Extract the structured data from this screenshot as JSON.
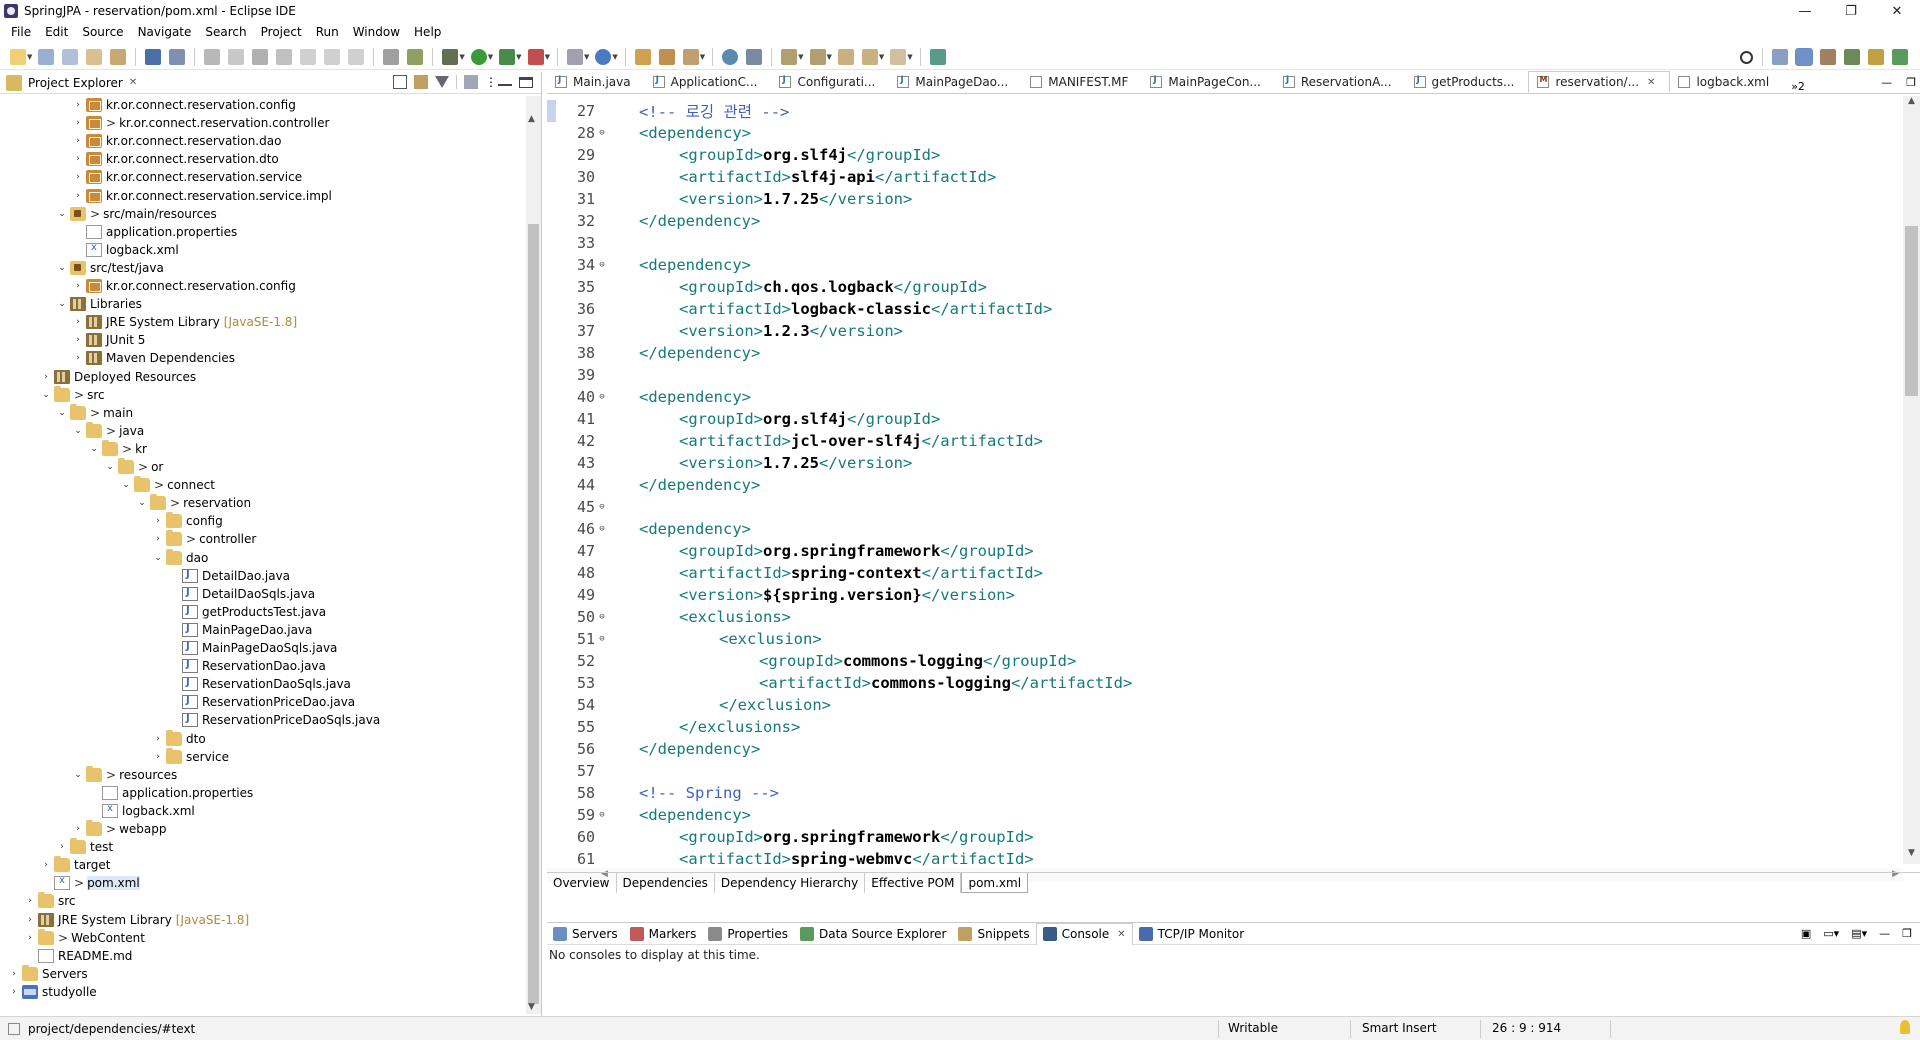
{
  "window": {
    "title": "SpringJPA - reservation/pom.xml - Eclipse IDE"
  },
  "menu": [
    "File",
    "Edit",
    "Source",
    "Navigate",
    "Search",
    "Project",
    "Run",
    "Window",
    "Help"
  ],
  "explorer": {
    "tab_label": "Project Explorer",
    "tree": [
      {
        "depth": 5,
        "tw": ">",
        "icon": "pkg",
        "gt": "",
        "label": "kr.or.connect.reservation.config"
      },
      {
        "depth": 5,
        "tw": ">",
        "icon": "pkg",
        "gt": ">",
        "label": "kr.or.connect.reservation.controller"
      },
      {
        "depth": 5,
        "tw": ">",
        "icon": "pkg",
        "gt": "",
        "label": "kr.or.connect.reservation.dao"
      },
      {
        "depth": 5,
        "tw": ">",
        "icon": "pkg",
        "gt": "",
        "label": "kr.or.connect.reservation.dto"
      },
      {
        "depth": 5,
        "tw": ">",
        "icon": "pkg",
        "gt": "",
        "label": "kr.or.connect.reservation.service"
      },
      {
        "depth": 5,
        "tw": ">",
        "icon": "pkg",
        "gt": "",
        "label": "kr.or.connect.reservation.service.impl"
      },
      {
        "depth": 4,
        "tw": "v",
        "icon": "srcf",
        "gt": ">",
        "label": "src/main/resources"
      },
      {
        "depth": 5,
        "tw": "",
        "icon": "file",
        "gt": "",
        "label": "application.properties"
      },
      {
        "depth": 5,
        "tw": "",
        "icon": "xml",
        "gt": "",
        "label": "logback.xml"
      },
      {
        "depth": 4,
        "tw": "v",
        "icon": "srcf",
        "gt": "",
        "label": "src/test/java"
      },
      {
        "depth": 5,
        "tw": ">",
        "icon": "pkg",
        "gt": "",
        "label": "kr.or.connect.reservation.config"
      },
      {
        "depth": 4,
        "tw": "v",
        "icon": "lib",
        "gt": "",
        "label": "Libraries"
      },
      {
        "depth": 5,
        "tw": ">",
        "icon": "lib",
        "gt": "",
        "label": "JRE System Library",
        "ann": "[JavaSE-1.8]"
      },
      {
        "depth": 5,
        "tw": ">",
        "icon": "lib",
        "gt": "",
        "label": "JUnit 5"
      },
      {
        "depth": 5,
        "tw": ">",
        "icon": "lib",
        "gt": "",
        "label": "Maven Dependencies"
      },
      {
        "depth": 3,
        "tw": ">",
        "icon": "lib",
        "gt": "",
        "label": "Deployed Resources"
      },
      {
        "depth": 3,
        "tw": "v",
        "icon": "folder",
        "gt": ">",
        "label": "src"
      },
      {
        "depth": 4,
        "tw": "v",
        "icon": "folder",
        "gt": ">",
        "label": "main"
      },
      {
        "depth": 5,
        "tw": "v",
        "icon": "folder",
        "gt": ">",
        "label": "java"
      },
      {
        "depth": 6,
        "tw": "v",
        "icon": "folder",
        "gt": ">",
        "label": "kr"
      },
      {
        "depth": 7,
        "tw": "v",
        "icon": "folder",
        "gt": ">",
        "label": "or"
      },
      {
        "depth": 8,
        "tw": "v",
        "icon": "folder",
        "gt": ">",
        "label": "connect"
      },
      {
        "depth": 9,
        "tw": "v",
        "icon": "folder",
        "gt": ">",
        "label": "reservation"
      },
      {
        "depth": 10,
        "tw": ">",
        "icon": "folder",
        "gt": "",
        "label": "config"
      },
      {
        "depth": 10,
        "tw": ">",
        "icon": "folder",
        "gt": ">",
        "label": "controller"
      },
      {
        "depth": 10,
        "tw": "v",
        "icon": "folder",
        "gt": "",
        "label": "dao"
      },
      {
        "depth": 11,
        "tw": "",
        "icon": "java",
        "gt": "",
        "label": "DetailDao.java"
      },
      {
        "depth": 11,
        "tw": "",
        "icon": "java",
        "gt": "",
        "label": "DetailDaoSqls.java"
      },
      {
        "depth": 11,
        "tw": "",
        "icon": "java",
        "gt": "",
        "label": "getProductsTest.java"
      },
      {
        "depth": 11,
        "tw": "",
        "icon": "java",
        "gt": "",
        "label": "MainPageDao.java"
      },
      {
        "depth": 11,
        "tw": "",
        "icon": "java",
        "gt": "",
        "label": "MainPageDaoSqls.java"
      },
      {
        "depth": 11,
        "tw": "",
        "icon": "java",
        "gt": "",
        "label": "ReservationDao.java"
      },
      {
        "depth": 11,
        "tw": "",
        "icon": "java",
        "gt": "",
        "label": "ReservationDaoSqls.java"
      },
      {
        "depth": 11,
        "tw": "",
        "icon": "java",
        "gt": "",
        "label": "ReservationPriceDao.java"
      },
      {
        "depth": 11,
        "tw": "",
        "icon": "java",
        "gt": "",
        "label": "ReservationPriceDaoSqls.java"
      },
      {
        "depth": 10,
        "tw": ">",
        "icon": "folder",
        "gt": "",
        "label": "dto"
      },
      {
        "depth": 10,
        "tw": ">",
        "icon": "folder",
        "gt": "",
        "label": "service"
      },
      {
        "depth": 5,
        "tw": "v",
        "icon": "folder",
        "gt": ">",
        "label": "resources"
      },
      {
        "depth": 6,
        "tw": "",
        "icon": "file",
        "gt": "",
        "label": "application.properties"
      },
      {
        "depth": 6,
        "tw": "",
        "icon": "xml",
        "gt": "",
        "label": "logback.xml"
      },
      {
        "depth": 5,
        "tw": ">",
        "icon": "folder",
        "gt": ">",
        "label": "webapp"
      },
      {
        "depth": 4,
        "tw": ">",
        "icon": "folder",
        "gt": "",
        "label": "test"
      },
      {
        "depth": 3,
        "tw": ">",
        "icon": "folder",
        "gt": "",
        "label": "target"
      },
      {
        "depth": 3,
        "tw": "",
        "icon": "xml",
        "gt": ">",
        "label": "pom.xml",
        "selected": true
      },
      {
        "depth": 2,
        "tw": ">",
        "icon": "folder",
        "gt": "",
        "label": "src"
      },
      {
        "depth": 2,
        "tw": ">",
        "icon": "lib",
        "gt": "",
        "label": "JRE System Library",
        "ann": "[JavaSE-1.8]"
      },
      {
        "depth": 2,
        "tw": ">",
        "icon": "folder",
        "gt": ">",
        "label": "WebContent"
      },
      {
        "depth": 2,
        "tw": "",
        "icon": "file",
        "gt": "",
        "label": "README.md"
      },
      {
        "depth": 1,
        "tw": ">",
        "icon": "folder",
        "gt": "",
        "label": "Servers"
      },
      {
        "depth": 1,
        "tw": ">",
        "icon": "proj",
        "gt": "",
        "label": "studyolle"
      }
    ]
  },
  "editor": {
    "tabs": [
      {
        "label": "Main.java",
        "icon": "j"
      },
      {
        "label": "ApplicationC...",
        "icon": "j"
      },
      {
        "label": "Configurati...",
        "icon": "j"
      },
      {
        "label": "MainPageDao...",
        "icon": "j"
      },
      {
        "label": "MANIFEST.MF",
        "icon": "f"
      },
      {
        "label": "MainPageCon...",
        "icon": "j"
      },
      {
        "label": "ReservationA...",
        "icon": "j"
      },
      {
        "label": "getProducts...",
        "icon": "j"
      },
      {
        "label": "reservation/...",
        "icon": "m",
        "active": true
      },
      {
        "label": "logback.xml",
        "icon": "x"
      }
    ],
    "more_tabs": "»2",
    "lines": [
      {
        "n": "27",
        "fold": "",
        "indent": 1,
        "parts": [
          [
            "cmt",
            "<!-- 로깅 관련 -->"
          ]
        ]
      },
      {
        "n": "28",
        "fold": "⊖",
        "indent": 1,
        "parts": [
          [
            "tag",
            "<dependency>"
          ]
        ]
      },
      {
        "n": "29",
        "fold": "",
        "indent": 2,
        "parts": [
          [
            "tag",
            "<groupId>"
          ],
          [
            "txtb",
            "org.slf4j"
          ],
          [
            "tag",
            "</groupId>"
          ]
        ]
      },
      {
        "n": "30",
        "fold": "",
        "indent": 2,
        "parts": [
          [
            "tag",
            "<artifactId>"
          ],
          [
            "txtb",
            "slf4j-api"
          ],
          [
            "tag",
            "</artifactId>"
          ]
        ]
      },
      {
        "n": "31",
        "fold": "",
        "indent": 2,
        "parts": [
          [
            "tag",
            "<version>"
          ],
          [
            "txtb",
            "1.7.25"
          ],
          [
            "tag",
            "</version>"
          ]
        ]
      },
      {
        "n": "32",
        "fold": "",
        "indent": 1,
        "parts": [
          [
            "tag",
            "</dependency>"
          ]
        ]
      },
      {
        "n": "33",
        "fold": "",
        "indent": 0,
        "parts": []
      },
      {
        "n": "34",
        "fold": "⊖",
        "indent": 1,
        "parts": [
          [
            "tag",
            "<dependency>"
          ]
        ]
      },
      {
        "n": "35",
        "fold": "",
        "indent": 2,
        "parts": [
          [
            "tag",
            "<groupId>"
          ],
          [
            "txtb",
            "ch.qos.logback"
          ],
          [
            "tag",
            "</groupId>"
          ]
        ]
      },
      {
        "n": "36",
        "fold": "",
        "indent": 2,
        "parts": [
          [
            "tag",
            "<artifactId>"
          ],
          [
            "txtb",
            "logback-classic"
          ],
          [
            "tag",
            "</artifactId>"
          ]
        ]
      },
      {
        "n": "37",
        "fold": "",
        "indent": 2,
        "parts": [
          [
            "tag",
            "<version>"
          ],
          [
            "txtb",
            "1.2.3"
          ],
          [
            "tag",
            "</version>"
          ]
        ]
      },
      {
        "n": "38",
        "fold": "",
        "indent": 1,
        "parts": [
          [
            "tag",
            "</dependency>"
          ]
        ]
      },
      {
        "n": "39",
        "fold": "",
        "indent": 0,
        "parts": []
      },
      {
        "n": "40",
        "fold": "⊖",
        "indent": 1,
        "parts": [
          [
            "tag",
            "<dependency>"
          ]
        ]
      },
      {
        "n": "41",
        "fold": "",
        "indent": 2,
        "parts": [
          [
            "tag",
            "<groupId>"
          ],
          [
            "txtb",
            "org.slf4j"
          ],
          [
            "tag",
            "</groupId>"
          ]
        ]
      },
      {
        "n": "42",
        "fold": "",
        "indent": 2,
        "parts": [
          [
            "tag",
            "<artifactId>"
          ],
          [
            "txtb",
            "jcl-over-slf4j"
          ],
          [
            "tag",
            "</artifactId>"
          ]
        ]
      },
      {
        "n": "43",
        "fold": "",
        "indent": 2,
        "parts": [
          [
            "tag",
            "<version>"
          ],
          [
            "txtb",
            "1.7.25"
          ],
          [
            "tag",
            "</version>"
          ]
        ]
      },
      {
        "n": "44",
        "fold": "",
        "indent": 1,
        "parts": [
          [
            "tag",
            "</dependency>"
          ]
        ]
      },
      {
        "n": "45",
        "fold": "⊖",
        "indent": 0,
        "parts": []
      },
      {
        "n": "46",
        "fold": "⊖",
        "indent": 1,
        "parts": [
          [
            "tag",
            "<dependency>"
          ]
        ]
      },
      {
        "n": "47",
        "fold": "",
        "indent": 2,
        "parts": [
          [
            "tag",
            "<groupId>"
          ],
          [
            "txtb",
            "org.springframework"
          ],
          [
            "tag",
            "</groupId>"
          ]
        ]
      },
      {
        "n": "48",
        "fold": "",
        "indent": 2,
        "parts": [
          [
            "tag",
            "<artifactId>"
          ],
          [
            "txtb",
            "spring-context"
          ],
          [
            "tag",
            "</artifactId>"
          ]
        ]
      },
      {
        "n": "49",
        "fold": "",
        "indent": 2,
        "parts": [
          [
            "tag",
            "<version>"
          ],
          [
            "txtb",
            "${spring.version}"
          ],
          [
            "tag",
            "</version>"
          ]
        ]
      },
      {
        "n": "50",
        "fold": "⊖",
        "indent": 2,
        "parts": [
          [
            "tag",
            "<exclusions>"
          ]
        ]
      },
      {
        "n": "51",
        "fold": "⊖",
        "indent": 3,
        "parts": [
          [
            "tag",
            "<exclusion>"
          ]
        ]
      },
      {
        "n": "52",
        "fold": "",
        "indent": 4,
        "parts": [
          [
            "tag",
            "<groupId>"
          ],
          [
            "txtb",
            "commons-logging"
          ],
          [
            "tag",
            "</groupId>"
          ]
        ]
      },
      {
        "n": "53",
        "fold": "",
        "indent": 4,
        "parts": [
          [
            "tag",
            "<artifactId>"
          ],
          [
            "txtb",
            "commons-logging"
          ],
          [
            "tag",
            "</artifactId>"
          ]
        ]
      },
      {
        "n": "54",
        "fold": "",
        "indent": 3,
        "parts": [
          [
            "tag",
            "</exclusion>"
          ]
        ]
      },
      {
        "n": "55",
        "fold": "",
        "indent": 2,
        "parts": [
          [
            "tag",
            "</exclusions>"
          ]
        ]
      },
      {
        "n": "56",
        "fold": "",
        "indent": 1,
        "parts": [
          [
            "tag",
            "</dependency>"
          ]
        ]
      },
      {
        "n": "57",
        "fold": "",
        "indent": 0,
        "parts": []
      },
      {
        "n": "58",
        "fold": "",
        "indent": 1,
        "parts": [
          [
            "cmt",
            "<!-- Spring -->"
          ]
        ]
      },
      {
        "n": "59",
        "fold": "⊖",
        "indent": 1,
        "parts": [
          [
            "tag",
            "<dependency>"
          ]
        ]
      },
      {
        "n": "60",
        "fold": "",
        "indent": 2,
        "parts": [
          [
            "tag",
            "<groupId>"
          ],
          [
            "txtb",
            "org.springframework"
          ],
          [
            "tag",
            "</groupId>"
          ]
        ]
      },
      {
        "n": "61",
        "fold": "",
        "indent": 2,
        "parts": [
          [
            "tag",
            "<artifactId>"
          ],
          [
            "txtb",
            "spring-webmvc"
          ],
          [
            "tag",
            "</artifactId>"
          ]
        ]
      }
    ],
    "pom_tabs": [
      "Overview",
      "Dependencies",
      "Dependency Hierarchy",
      "Effective POM",
      "pom.xml"
    ],
    "pom_active": "pom.xml"
  },
  "console": {
    "tabs": [
      {
        "label": "Servers",
        "color": "#6a8fc0"
      },
      {
        "label": "Markers",
        "color": "#c05a5a"
      },
      {
        "label": "Properties",
        "color": "#8a8a8a"
      },
      {
        "label": "Data Source Explorer",
        "color": "#5a9a5a"
      },
      {
        "label": "Snippets",
        "color": "#c0a060"
      },
      {
        "label": "Console",
        "color": "#3a5a8a",
        "active": true
      },
      {
        "label": "TCP/IP Monitor",
        "color": "#4a6ab0"
      }
    ],
    "message": "No consoles to display at this time."
  },
  "status": {
    "path": "project/dependencies/#text",
    "writable": "Writable",
    "insert_mode": "Smart Insert",
    "position": "26 : 9 : 914"
  }
}
